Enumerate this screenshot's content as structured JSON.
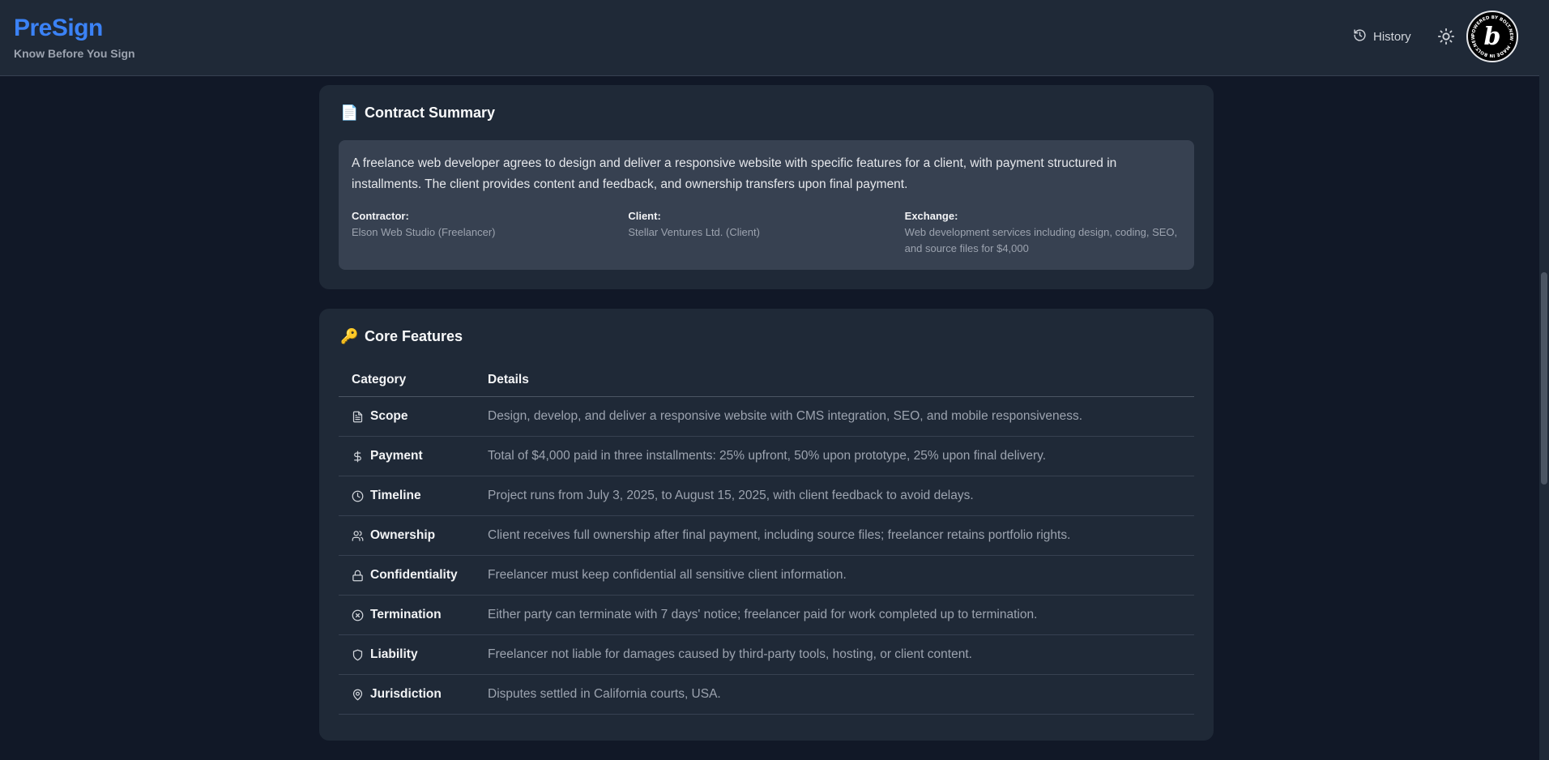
{
  "header": {
    "brand_title": "PreSign",
    "brand_tagline": "Know Before You Sign",
    "history_label": "History",
    "history_icon": "history-icon",
    "theme_icon": "sun-icon",
    "badge_letter": "b",
    "badge_text": "POWERED BY BOLT.NEW · MADE IN BOLT.NEW"
  },
  "summary": {
    "icon": "📄",
    "title": "Contract Summary",
    "text": "A freelance web developer agrees to design and deliver a responsive website with specific features for a client, with payment structured in installments. The client provides content and feedback, and ownership transfers upon final payment.",
    "parties": [
      {
        "label": "Contractor:",
        "value": "Elson Web Studio (Freelancer)"
      },
      {
        "label": "Client:",
        "value": "Stellar Ventures Ltd. (Client)"
      },
      {
        "label": "Exchange:",
        "value": "Web development services including design, coding, SEO, and source files for $4,000"
      }
    ]
  },
  "features": {
    "icon": "🔑",
    "title": "Core Features",
    "columns": [
      "Category",
      "Details"
    ],
    "rows": [
      {
        "icon": "document-icon",
        "category": "Scope",
        "details": "Design, develop, and deliver a responsive website with CMS integration, SEO, and mobile responsiveness."
      },
      {
        "icon": "dollar-icon",
        "category": "Payment",
        "details": "Total of $4,000 paid in three installments: 25% upfront, 50% upon prototype, 25% upon final delivery."
      },
      {
        "icon": "clock-icon",
        "category": "Timeline",
        "details": "Project runs from July 3, 2025, to August 15, 2025, with client feedback to avoid delays."
      },
      {
        "icon": "users-icon",
        "category": "Ownership",
        "details": "Client receives full ownership after final payment, including source files; freelancer retains portfolio rights."
      },
      {
        "icon": "lock-icon",
        "category": "Confidentiality",
        "details": "Freelancer must keep confidential all sensitive client information."
      },
      {
        "icon": "x-circle-icon",
        "category": "Termination",
        "details": "Either party can terminate with 7 days' notice; freelancer paid for work completed up to termination."
      },
      {
        "icon": "shield-icon",
        "category": "Liability",
        "details": "Freelancer not liable for damages caused by third-party tools, hosting, or client content."
      },
      {
        "icon": "map-pin-icon",
        "category": "Jurisdiction",
        "details": "Disputes settled in California courts, USA."
      }
    ]
  },
  "colors": {
    "background": "#111827",
    "card": "#1f2937",
    "accent": "#3b82f6",
    "muted_text": "#9ca3af"
  }
}
